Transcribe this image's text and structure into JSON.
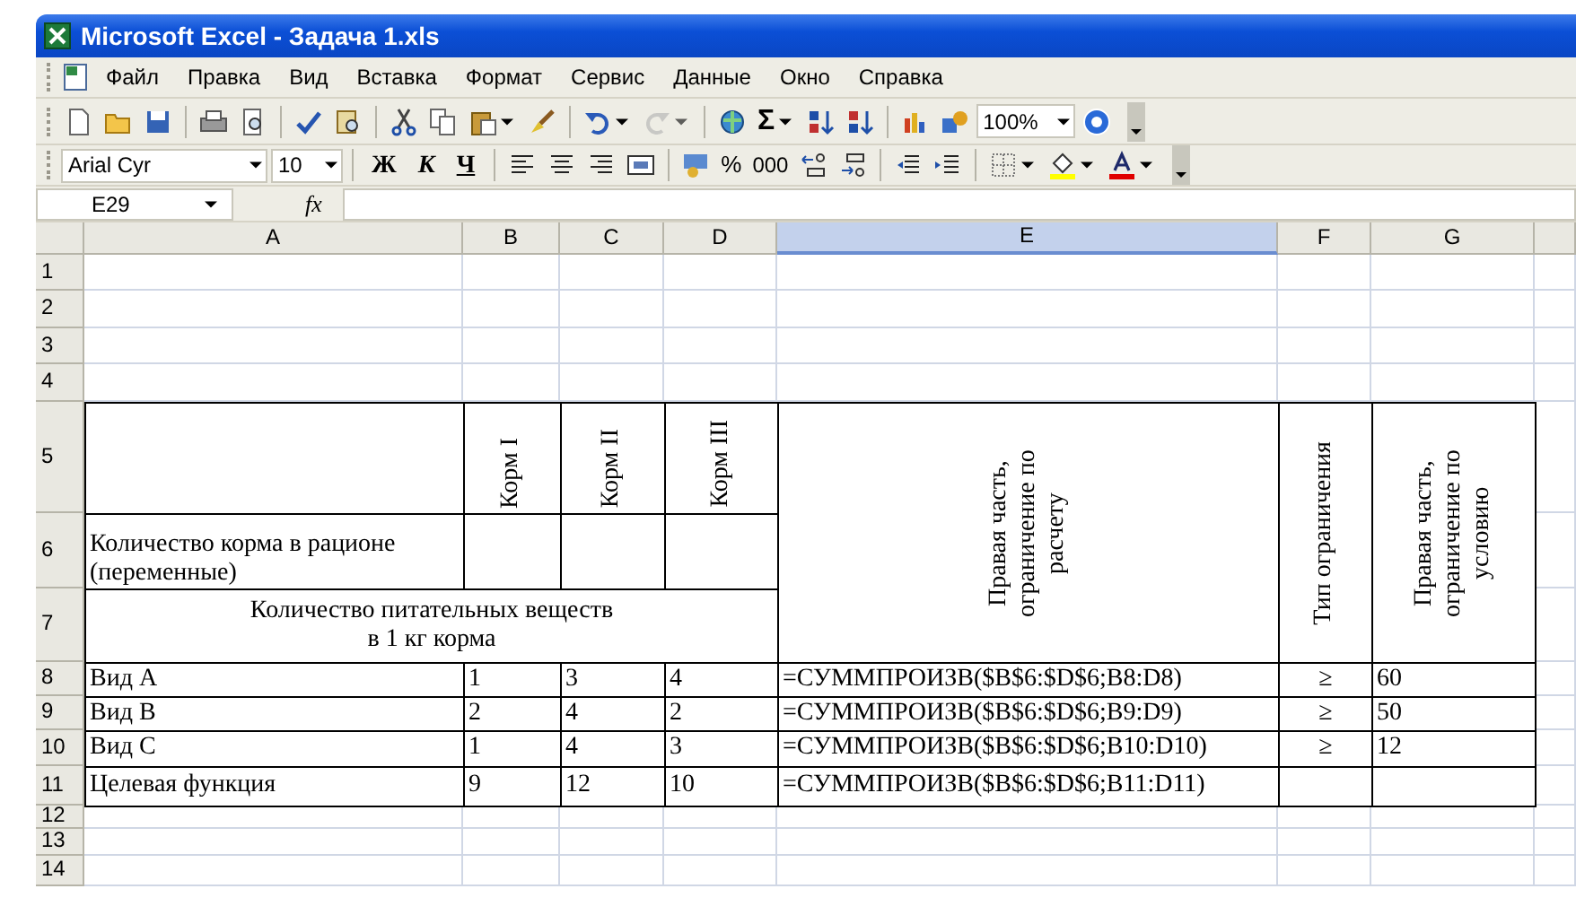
{
  "window": {
    "title": "Microsoft Excel - Задача 1.xls"
  },
  "menu": [
    {
      "label": "Файл"
    },
    {
      "label": "Правка"
    },
    {
      "label": "Вид"
    },
    {
      "label": "Вставка"
    },
    {
      "label": "Формат"
    },
    {
      "label": "Сервис"
    },
    {
      "label": "Данные"
    },
    {
      "label": "Окно"
    },
    {
      "label": "Справка"
    }
  ],
  "standard_toolbar": {
    "autosum": "Σ",
    "zoom": "100%",
    "redo_disabled": true
  },
  "formatting_toolbar": {
    "font": "Arial Cyr",
    "size": "10",
    "bold": "Ж",
    "italic": "К",
    "underline": "Ч",
    "percent": "%",
    "thousands": "000"
  },
  "formula_bar": {
    "name_box": "E29",
    "fx": "fx"
  },
  "sheet": {
    "columns": [
      {
        "label": "A",
        "selected": false
      },
      {
        "label": "B",
        "selected": false
      },
      {
        "label": "C",
        "selected": false
      },
      {
        "label": "D",
        "selected": false
      },
      {
        "label": "E",
        "selected": true
      },
      {
        "label": "F",
        "selected": false
      },
      {
        "label": "G",
        "selected": false
      }
    ],
    "row_numbers": [
      "1",
      "2",
      "3",
      "4",
      "5",
      "6",
      "7",
      "8",
      "9",
      "10",
      "11",
      "12",
      "13",
      "14"
    ],
    "feeds": [
      "Корм I",
      "Корм II",
      "Корм III"
    ],
    "rhs_calc_header": "Правая часть, ограничение по расчету",
    "constraint_type_header": "Тип ограничения",
    "rhs_cond_header": "Правая часть, ограничение по условию",
    "quantity_label": "Количество корма в рационе (переменные)",
    "nutrients_label": "Количество питательных веществ в 1 кг корма",
    "rows": [
      {
        "name": "Вид А",
        "values": [
          "1",
          "3",
          "4"
        ],
        "formula": "=СУММПРОИЗВ($B$6:$D$6;B8:D8)",
        "sign": "≥",
        "rhs": "60"
      },
      {
        "name": "Вид В",
        "values": [
          "2",
          "4",
          "2"
        ],
        "formula": "=СУММПРОИЗВ($B$6:$D$6;B9:D9)",
        "sign": "≥",
        "rhs": "50"
      },
      {
        "name": "Вид С",
        "values": [
          "1",
          "4",
          "3"
        ],
        "formula": "=СУММПРОИЗВ($B$6:$D$6;B10:D10)",
        "sign": "≥",
        "rhs": "12"
      },
      {
        "name": "Целевая функция",
        "values": [
          "9",
          "12",
          "10"
        ],
        "formula": "=СУММПРОИЗВ($B$6:$D$6;B11:D11)"
      }
    ]
  }
}
